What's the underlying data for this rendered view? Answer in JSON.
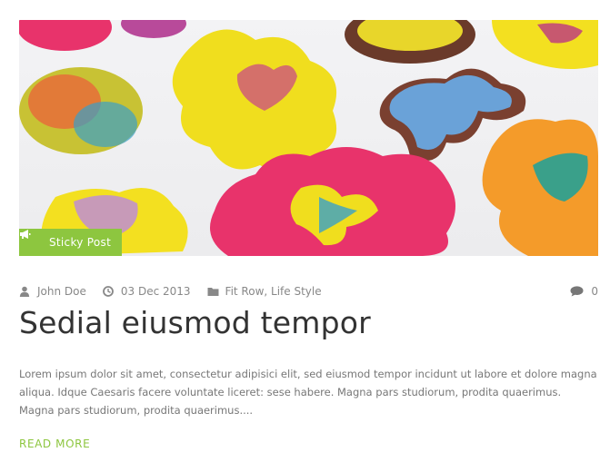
{
  "post": {
    "image_alt": "Decorated cookies",
    "sticky_label": "Sticky Post",
    "author": "John Doe",
    "date": "03 Dec 2013",
    "categories": "Fit Row, Life Style",
    "comment_count": "0",
    "title": "Sedial eiusmod tempor",
    "excerpt": "Lorem ipsum dolor sit amet, consectetur adipisici elit, sed eiusmod tempor incidunt ut labore et dolore magna aliqua. Idque Caesaris facere voluntate liceret: sese habere. Magna pars studiorum, prodita quaerimus. Magna pars studiorum, prodita quaerimus....",
    "read_more": "READ MORE"
  },
  "colors": {
    "accent": "#8dc63f",
    "title": "#333333",
    "meta": "#888888"
  },
  "icons": {
    "sticky": "bullhorn-icon",
    "author": "user-icon",
    "date": "clock-icon",
    "categories": "folder-icon",
    "comments": "comment-icon"
  }
}
